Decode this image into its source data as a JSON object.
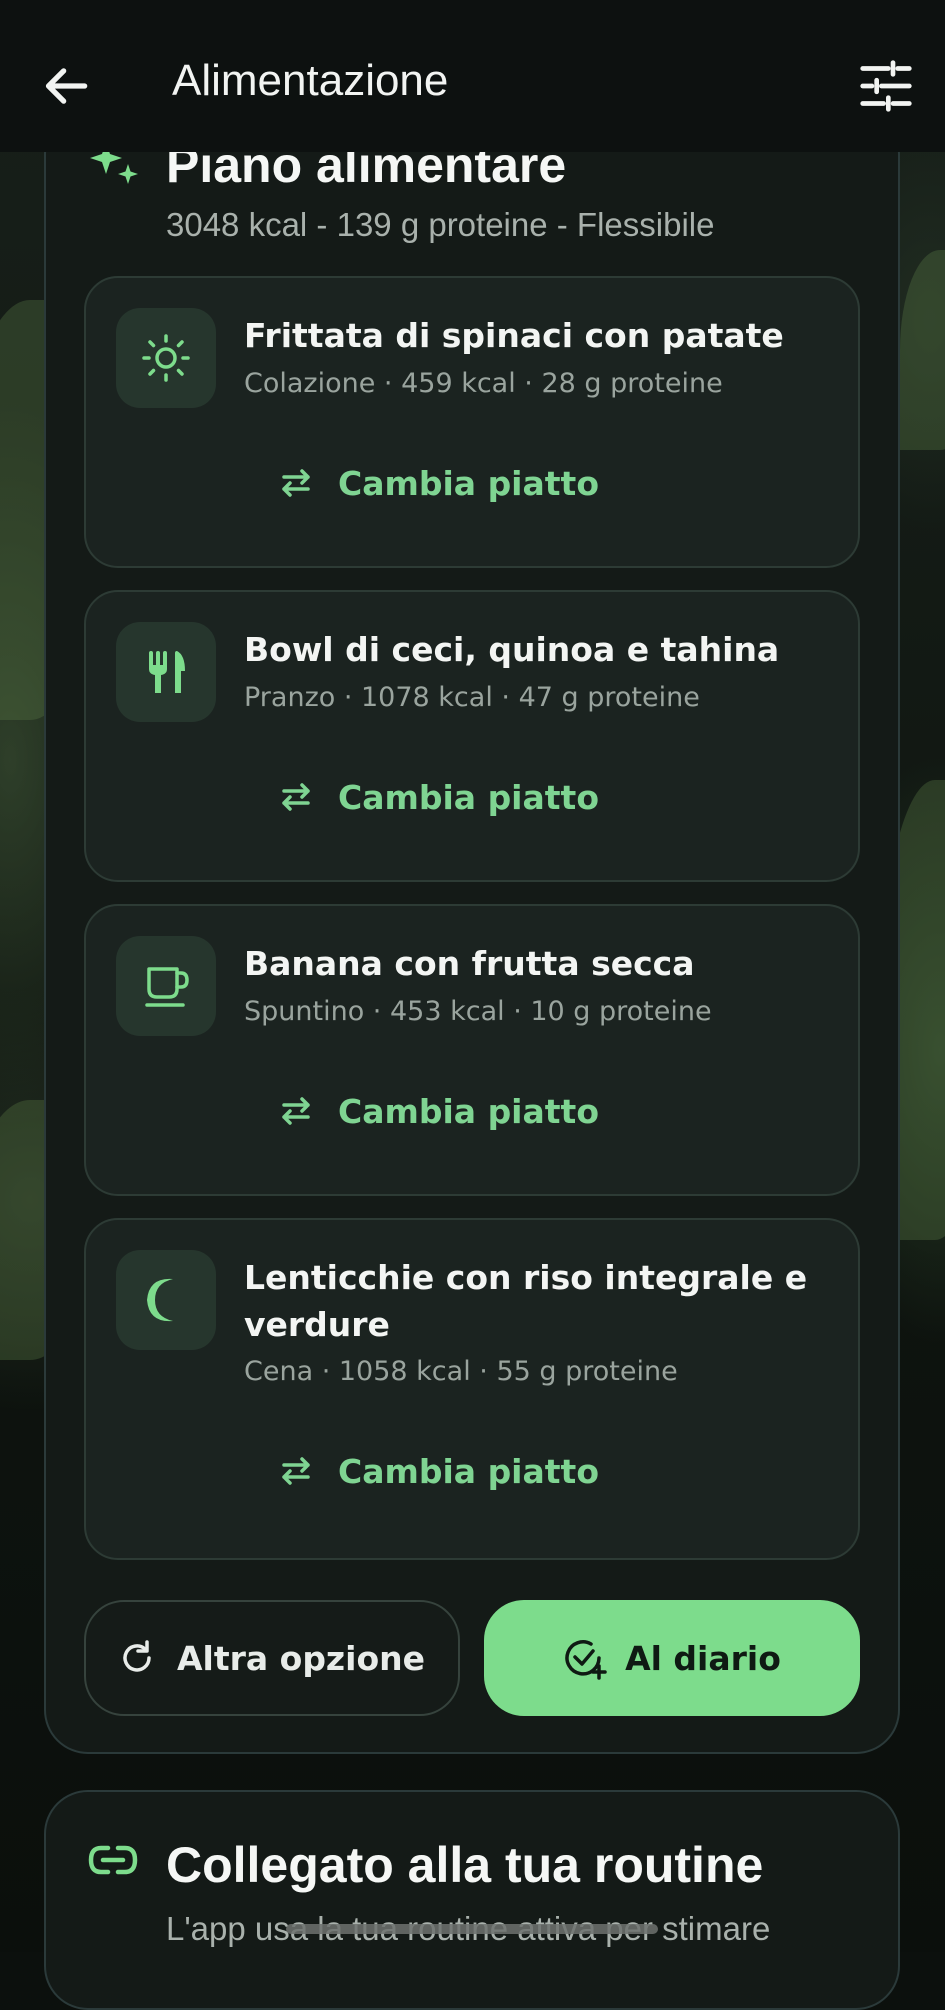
{
  "header": {
    "title": "Alimentazione",
    "back_icon": "arrow-left-icon",
    "filter_icon": "sliders-icon"
  },
  "plan": {
    "title": "Piano alimentare",
    "subtitle": "3048 kcal - 139 g proteine - Flessibile",
    "icon": "sparkle-icon",
    "meals": [
      {
        "name": "Frittata di spinaci con patate",
        "meta": "Colazione · 459 kcal · 28 g proteine",
        "icon": "sun-icon",
        "swap_label": "Cambia piatto"
      },
      {
        "name": "Bowl di ceci, quinoa e tahina",
        "meta": "Pranzo · 1078 kcal · 47 g proteine",
        "icon": "fork-knife-icon",
        "swap_label": "Cambia piatto"
      },
      {
        "name": "Banana con frutta secca",
        "meta": "Spuntino · 453 kcal · 10 g proteine",
        "icon": "cup-icon",
        "swap_label": "Cambia piatto"
      },
      {
        "name": "Lenticchie con riso integrale e verdure",
        "meta": "Cena · 1058 kcal · 55 g proteine",
        "icon": "moon-icon",
        "swap_label": "Cambia piatto"
      }
    ],
    "other_option_label": "Altra opzione",
    "to_diary_label": "Al diario"
  },
  "routine": {
    "title": "Collegato alla tua routine",
    "subtitle": "L'app usa la tua routine attiva per stimare",
    "icon": "link-icon"
  },
  "colors": {
    "accent": "#7ddc8c",
    "accent_text": "#7fd492",
    "card_bg": "#1b2320",
    "panel_bg": "#141a17"
  }
}
